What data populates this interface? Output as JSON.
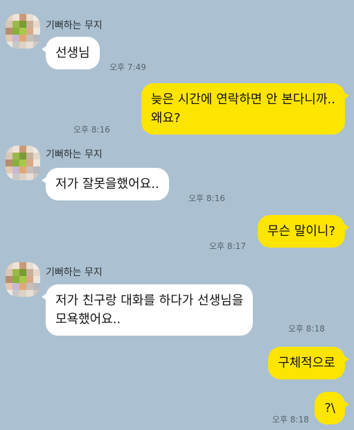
{
  "colors": {
    "background": "#abc1d1",
    "received_bubble": "#ffffff",
    "sent_bubble": "#fee500"
  },
  "avatar": {
    "icon": "pixelated-profile-picture"
  },
  "messages": [
    {
      "direction": "received",
      "sender": "기뻐하는 무지",
      "text": "선생님",
      "time": "오후 7:49"
    },
    {
      "direction": "sent",
      "lines": [
        "늦은 시간에 연락하면 안 본다니까..",
        "왜요?"
      ],
      "time": "오후 8:16"
    },
    {
      "direction": "received",
      "sender": "기뻐하는 무지",
      "text": "저가 잘못을했어요..",
      "time": "오후 8:16"
    },
    {
      "direction": "sent",
      "text": "무슨 말이니?",
      "time": "오후 8:17"
    },
    {
      "direction": "received",
      "sender": "기뻐하는 무지",
      "lines": [
        "저가  친구랑 대화를 하다가 선생님을",
        "모욕했어요.."
      ],
      "time": "오후 8:18"
    },
    {
      "direction": "sent",
      "text": "구체적으로",
      "time": ""
    },
    {
      "direction": "sent",
      "text": "?\\",
      "time": "오후 8:18"
    }
  ]
}
